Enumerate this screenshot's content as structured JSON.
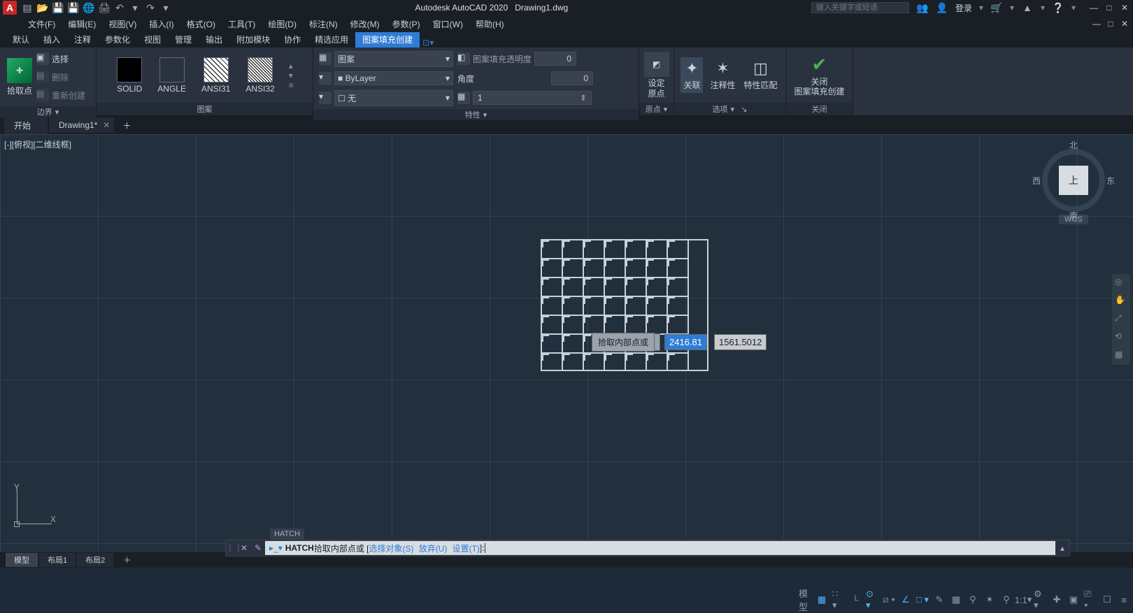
{
  "title": {
    "app": "Autodesk AutoCAD 2020",
    "file": "Drawing1.dwg"
  },
  "search_placeholder": "键入关键字或短语",
  "login_label": "登录",
  "menus": [
    "文件(F)",
    "编辑(E)",
    "视图(V)",
    "插入(I)",
    "格式(O)",
    "工具(T)",
    "绘图(D)",
    "标注(N)",
    "修改(M)",
    "参数(P)",
    "窗口(W)",
    "帮助(H)"
  ],
  "ribbon_tabs": [
    "默认",
    "插入",
    "注释",
    "参数化",
    "视图",
    "管理",
    "输出",
    "附加模块",
    "协作",
    "精选应用",
    "图案填充创建"
  ],
  "active_ribbon_tab": 10,
  "panels": {
    "boundary": {
      "pick": "拾取点",
      "select": "选择",
      "delete": "删除",
      "recreate": "重新创建",
      "label": "边界"
    },
    "pattern": {
      "items": [
        "SOLID",
        "ANGLE",
        "ANSI31",
        "ANSI32"
      ],
      "label": "图案"
    },
    "props": {
      "hatch_type": "图案",
      "color_label": "ByLayer",
      "none_label": "无",
      "transparency": "图案填充透明度",
      "transparency_val": "0",
      "angle": "角度",
      "angle_val": "0",
      "scale_val": "1",
      "label": "特性"
    },
    "origin": {
      "btn": "设定\n原点",
      "label": "原点"
    },
    "options": {
      "assoc": "关联",
      "annot": "注释性",
      "match": "特性匹配",
      "label": "选项"
    },
    "close": {
      "btn": "关闭\n图案填充创建",
      "label": "关闭"
    }
  },
  "file_tabs": {
    "start": "开始",
    "drawing": "Drawing1*"
  },
  "view_label": "[-][俯视][二维线框]",
  "viewcube": {
    "n": "北",
    "s": "南",
    "e": "东",
    "w": "西",
    "top": "上",
    "wcs": "WCS"
  },
  "dyn": {
    "prompt": "拾取内部点或",
    "x": "2416.81",
    "y": "1561.5012"
  },
  "cmd_tag": "HATCH",
  "cmd": {
    "keyword": "HATCH",
    "prompt_pre": " 拾取内部点或 [",
    "opt1": "选择对象(S)",
    "opt2": "放弃(U)",
    "opt3": "设置(T)",
    "suffix": "]: "
  },
  "model_tabs": [
    "模型",
    "布局1",
    "布局2"
  ],
  "status_ratio": "1:1",
  "ucs": {
    "x": "X",
    "y": "Y"
  }
}
